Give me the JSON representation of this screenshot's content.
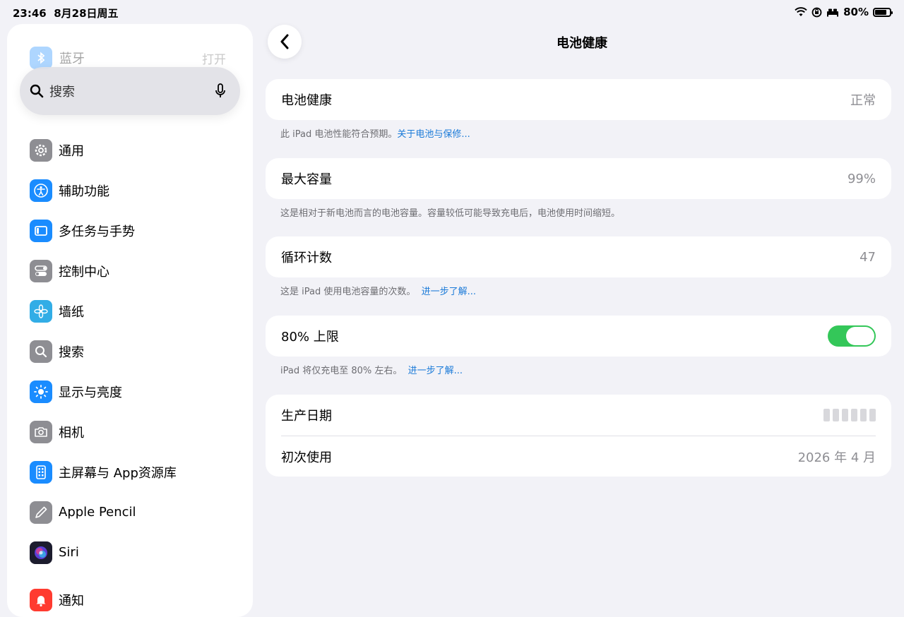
{
  "status_bar": {
    "time": "23:46",
    "date": "8月28日周五",
    "battery": "80%",
    "battery_level": 0.8
  },
  "sidebar": {
    "ghost_item": {
      "label": "蓝牙",
      "value": "打开"
    },
    "search": {
      "placeholder": "搜索"
    },
    "items": [
      {
        "label": "通用",
        "icon": "gear-icon",
        "color": "#8e8e93"
      },
      {
        "label": "辅助功能",
        "icon": "accessibility-icon",
        "color": "#1a8cff"
      },
      {
        "label": "多任务与手势",
        "icon": "multitasking-icon",
        "color": "#1a8cff"
      },
      {
        "label": "控制中心",
        "icon": "toggles-icon",
        "color": "#8e8e93"
      },
      {
        "label": "墙纸",
        "icon": "flower-icon",
        "color": "#32ade6"
      },
      {
        "label": "搜索",
        "icon": "search-icon",
        "color": "#8e8e93"
      },
      {
        "label": "显示与亮度",
        "icon": "sun-icon",
        "color": "#1a8cff"
      },
      {
        "label": "相机",
        "icon": "camera-icon",
        "color": "#8e8e93"
      },
      {
        "label": "主屏幕与 App资源库",
        "icon": "home-screen-icon",
        "color": "#1a8cff"
      },
      {
        "label": "Apple Pencil",
        "icon": "pencil-icon",
        "color": "#8e8e93"
      },
      {
        "label": "Siri",
        "icon": "siri-icon",
        "color": "#3a2e6e"
      },
      {
        "label": "通知",
        "icon": "bell-icon",
        "color": "#ff3b30"
      }
    ]
  },
  "main": {
    "title": "电池健康",
    "battery_health": {
      "label": "电池健康",
      "value": "正常",
      "note": "此 iPad 电池性能符合预期。",
      "link": "关于电池与保修..."
    },
    "max_capacity": {
      "label": "最大容量",
      "value": "99%",
      "note": "这是相对于新电池而言的电池容量。容量较低可能导致充电后，电池使用时间缩短。"
    },
    "cycle_count": {
      "label": "循环计数",
      "value": "47",
      "note": "这是 iPad 使用电池容量的次数。",
      "link": "进一步了解..."
    },
    "limit_80": {
      "label": "80% 上限",
      "enabled": true,
      "note": "iPad 将仅充电至 80% 左右。",
      "link": "进一步了解..."
    },
    "dates": {
      "manufacture_label": "生产日期",
      "first_use_label": "初次使用",
      "first_use_value": "2026 年 4 月"
    }
  },
  "colors": {
    "toggle_on": "#34c759",
    "link": "#1a7ad8"
  }
}
